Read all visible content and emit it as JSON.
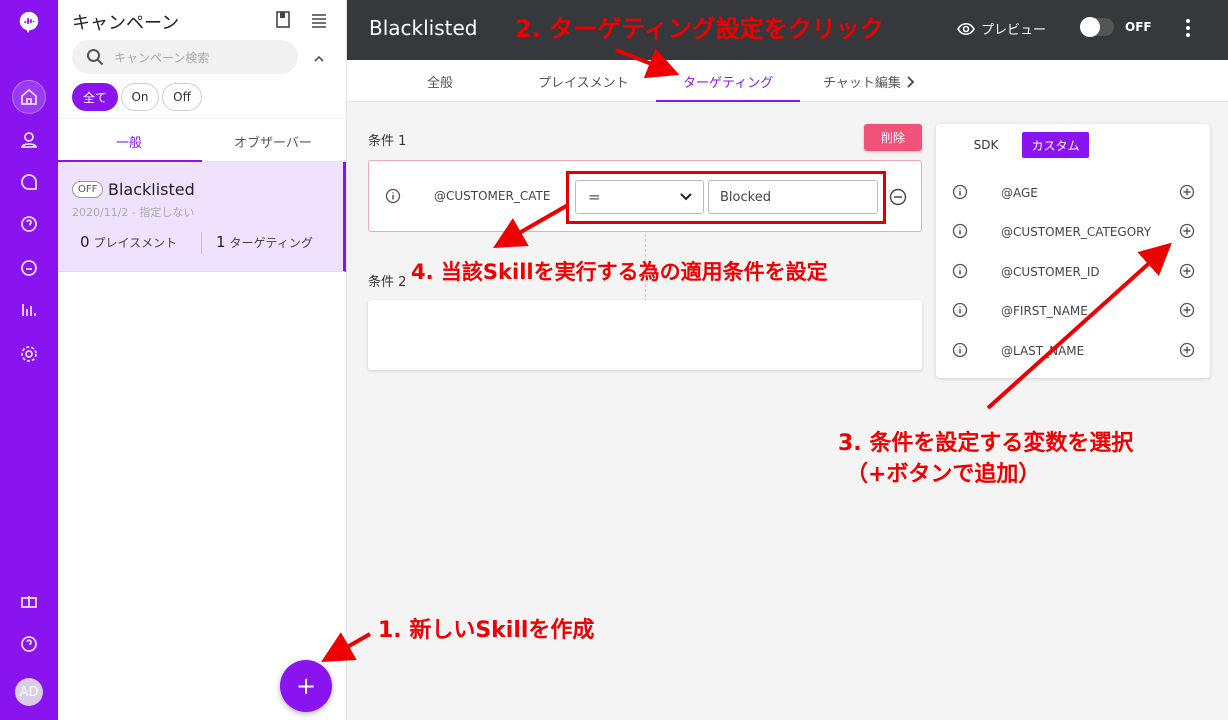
{
  "nav": {
    "icons": [
      "app-logo-icon",
      "home-icon",
      "user-icon",
      "chat-bubble-icon",
      "help-bubble-icon",
      "comment-icon",
      "bar-chart-icon",
      "settings-icon",
      "gift-icon",
      "help-icon"
    ],
    "avatar": "AD"
  },
  "sidebar": {
    "title": "キャンペーン",
    "search_placeholder": "キャンペーン検索",
    "filters": [
      "全て",
      "On",
      "Off"
    ],
    "tabs": [
      "一般",
      "オブザーバー"
    ],
    "campaign": {
      "status": "OFF",
      "name": "Blacklisted",
      "date": "2020/11/2 - 指定しない",
      "placements_count": "0",
      "placements_label": "プレイスメント",
      "targeting_count": "1",
      "targeting_label": "ターゲティング"
    },
    "add_label": "+"
  },
  "header": {
    "title": "Blacklisted",
    "preview_label": "プレビュー",
    "toggle_label": "OFF"
  },
  "tabs": [
    "全般",
    "プレイスメント",
    "ターゲティング",
    "チャット編集"
  ],
  "conditions": {
    "cond1_label": "条件 1",
    "delete_label": "削除",
    "variable": "@CUSTOMER_CATE",
    "operator": "=",
    "value": "Blocked",
    "cond2_label": "条件 2"
  },
  "variables_panel": {
    "tabs": [
      "SDK",
      "カスタム"
    ],
    "items": [
      "@AGE",
      "@CUSTOMER_CATEGORY",
      "@CUSTOMER_ID",
      "@FIRST_NAME",
      "@LAST_NAME"
    ]
  },
  "annotations": {
    "step1": "1. 新しいSkillを作成",
    "step2": "2. ターゲティング設定をクリック",
    "step3_line1": "3. 条件を設定する変数を選択",
    "step3_line2": "（+ボタンで追加）",
    "step4": "4. 当該Skillを実行する為の適用条件を設定"
  },
  "colors": {
    "accent": "#8a14f0",
    "header": "#37383b",
    "delete": "#f0527a",
    "annotation": "#ee0000"
  }
}
